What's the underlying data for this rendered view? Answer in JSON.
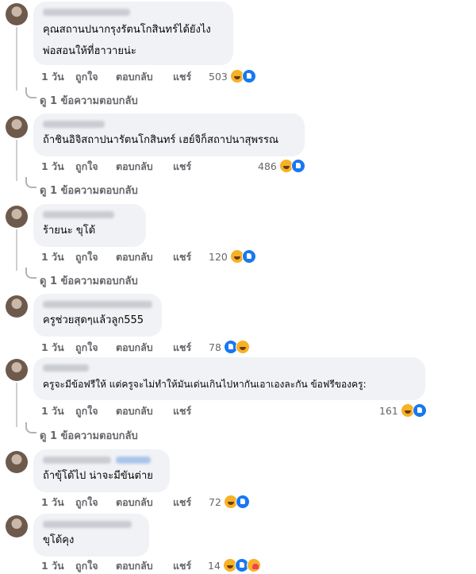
{
  "comments": [
    {
      "text_lines": [
        "คุณสถานปนากรุงรัตนโกสินทร์ได้ยังไง",
        "พ่อสอนให้ที่ฮาวายน่ะ"
      ],
      "actions": {
        "time": "1 วัน",
        "like": "ถูกใจ",
        "reply": "ตอบกลับ",
        "share": "แชร์"
      },
      "reaction_count": "503",
      "reactions": [
        "haha-icon",
        "like-icon"
      ],
      "replies_link": "ดู 1 ข้อความตอบกลับ"
    },
    {
      "text_lines": [
        "ถ้าชินอิจิสถาปนารัตนโกสินทร์ เฮย์จิก็สถาปนาสุพรรณ"
      ],
      "actions": {
        "time": "1 วัน",
        "like": "ถูกใจ",
        "reply": "ตอบกลับ",
        "share": "แชร์"
      },
      "reaction_count": "486",
      "reactions": [
        "haha-icon",
        "like-icon"
      ],
      "replies_link": "ดู 1 ข้อความตอบกลับ"
    },
    {
      "text_lines": [
        "ร้ายนะ ขุโด้"
      ],
      "actions": {
        "time": "1 วัน",
        "like": "ถูกใจ",
        "reply": "ตอบกลับ",
        "share": "แชร์"
      },
      "reaction_count": "120",
      "reactions": [
        "haha-icon",
        "like-icon"
      ],
      "replies_link": "ดู 1 ข้อความตอบกลับ"
    },
    {
      "text_lines": [
        "ครูช่วยสุดๆแล้วลูก555"
      ],
      "actions": {
        "time": "1 วัน",
        "like": "ถูกใจ",
        "reply": "ตอบกลับ",
        "share": "แชร์"
      },
      "reaction_count": "78",
      "reactions": [
        "like-icon",
        "haha-icon"
      ],
      "replies_link": ""
    },
    {
      "text_lines": [
        "ครูจะมีข้อฟรีให้ แต่ครูจะไม่ทำให้มันเด่นเกินไปหากันเอาเองละกัน ข้อฟรีของครู:"
      ],
      "actions": {
        "time": "1 วัน",
        "like": "ถูกใจ",
        "reply": "ตอบกลับ",
        "share": "แชร์"
      },
      "reaction_count": "161",
      "reactions": [
        "haha-icon",
        "like-icon"
      ],
      "replies_link": "ดู 1 ข้อความตอบกลับ"
    },
    {
      "text_lines": [
        "ถ้าขุ้โด้ไป น่าจะมีขันต่าย"
      ],
      "actions": {
        "time": "1 วัน",
        "like": "ถูกใจ",
        "reply": "ตอบกลับ",
        "share": "แชร์"
      },
      "reaction_count": "72",
      "reactions": [
        "haha-icon",
        "like-icon"
      ],
      "replies_link": ""
    },
    {
      "text_lines": [
        "ขุโด้คุง"
      ],
      "actions": {
        "time": "1 วัน",
        "like": "ถูกใจ",
        "reply": "ตอบกลับ",
        "share": "แชร์"
      },
      "reaction_count": "14",
      "reactions": [
        "haha-icon",
        "like-icon",
        "care-icon"
      ],
      "replies_link": ""
    }
  ]
}
